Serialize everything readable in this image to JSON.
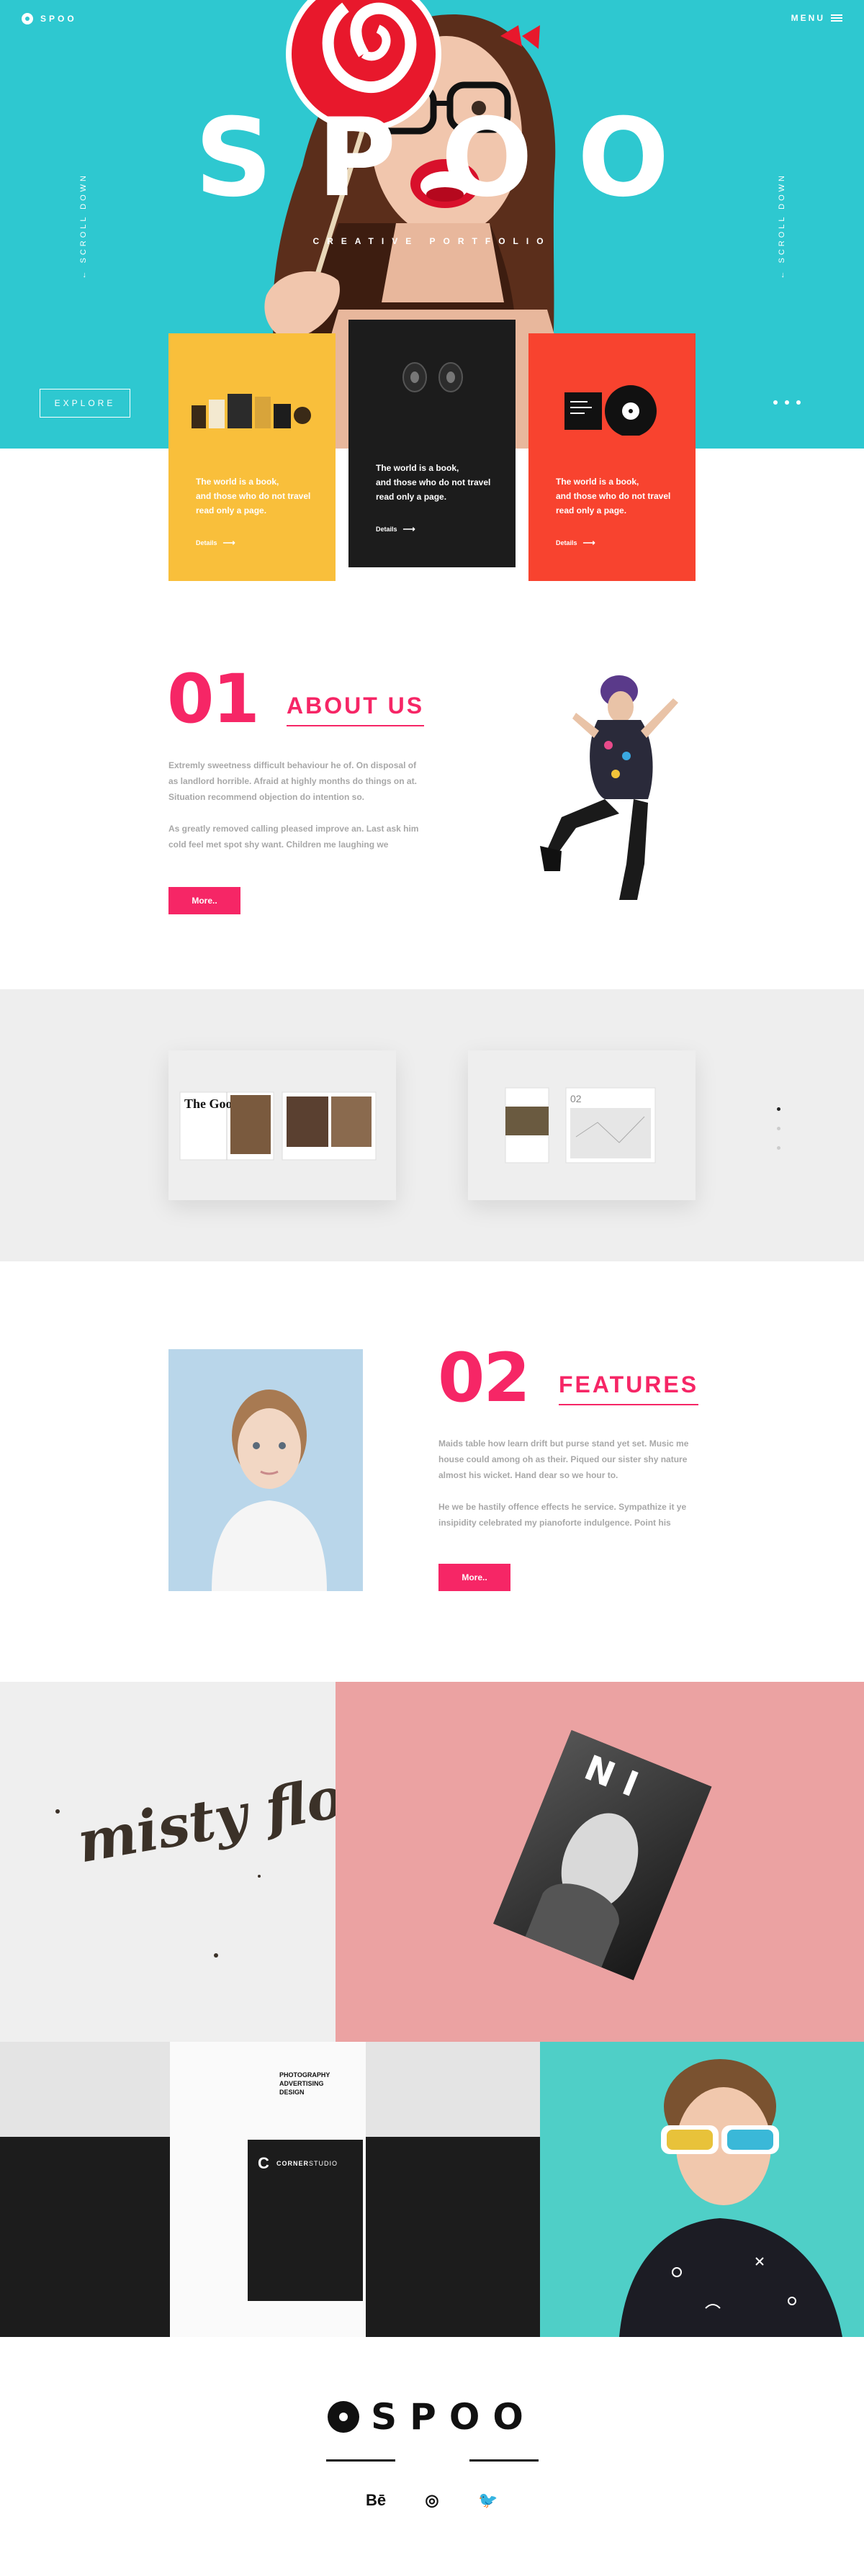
{
  "nav": {
    "logo_text": "SPOO",
    "menu_label": "MENU"
  },
  "hero": {
    "title": "SPOO",
    "subtitle": "CREATIVE PORTFOLIO",
    "scroll_label": "← SCROLL DOWN",
    "explore_label": "EXPLORE",
    "bg_color": "#2ec8d0"
  },
  "cards": [
    {
      "text_1": "The world is a book,",
      "text_2": "and those who do not travel",
      "text_3": "read only a page.",
      "link": "Details",
      "color": "#f9bf3b"
    },
    {
      "text_1": "The world is a book,",
      "text_2": "and those who do not travel",
      "text_3": "read only a page.",
      "link": "Details",
      "color": "#1c1c1c"
    },
    {
      "text_1": "The world is a book,",
      "text_2": "and those who do not travel",
      "text_3": "read only a page.",
      "link": "Details",
      "color": "#f8432f"
    }
  ],
  "about": {
    "number": "01",
    "title": "ABOUT US",
    "para_1": "Extremly sweetness difficult behaviour he of. On disposal of as landlord horrible. Afraid at highly months do things on at. Situation recommend objection do intention so.",
    "para_2": "As greatly removed calling pleased improve an. Last ask him cold feel met spot shy want. Children me laughing we",
    "button": "More.."
  },
  "features": {
    "number": "02",
    "title": "FEATURES",
    "para_1": "Maids table how learn drift but purse stand yet set. Music me house could among oh as their. Piqued our sister shy nature almost his wicket. Hand dear so we hour to.",
    "para_2": "He we be hastily offence effects he service. Sympathize it ye insipidity celebrated my pianoforte indulgence. Point his",
    "button": "More.."
  },
  "gallery": {
    "book_1": "The Goods",
    "book_2": "02"
  },
  "mosaic": {
    "lettering": "misty flora",
    "magazine": "N  I",
    "poster_lines": [
      "PHOTOGRAPHY",
      "ADVERTISING",
      "DESIGN"
    ],
    "poster_brand_1": "CORNER",
    "poster_brand_2": "STUDIO"
  },
  "footer": {
    "logo_text": "SPOO",
    "social": [
      "Bē",
      "◎",
      "🐦"
    ]
  },
  "colors": {
    "accent": "#f62666",
    "yellow": "#f9bf3b",
    "red": "#f8432f",
    "teal": "#2ec8d0"
  }
}
